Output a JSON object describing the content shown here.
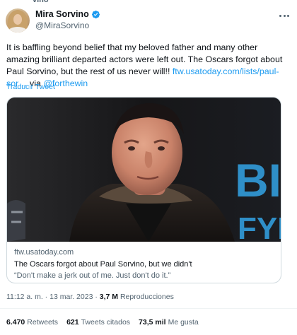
{
  "top_clip": "vino",
  "author": {
    "display_name": "Mira Sorvino",
    "handle": "@MiraSorvino",
    "verified": true,
    "verified_color": "#1d9bf0"
  },
  "tweet": {
    "text_before": "It is baffling beyond belief that my beloved father and many other amazing brilliant departed actors were left out. The Oscars forgot about Paul Sorvino, but the rest of us never will!! ",
    "link_text": "ftw.usatoday.com/lists/paul-sor…",
    "via_text": " via ",
    "mention": "@forthewin",
    "translate_label": "Traducir Tweet"
  },
  "card": {
    "domain": "ftw.usatoday.com",
    "title": "The Oscars forgot about Paul Sorvino, but we didn't",
    "description": "“Don't make a jerk out of me. Just don't do it.”",
    "backdrop_text_1": "BI",
    "backdrop_text_2": "FYI"
  },
  "meta": {
    "time": "11:12 a. m.",
    "separator": " · ",
    "date": "13 mar. 2023",
    "views_value": "3,7 M",
    "views_label": "Reproducciones"
  },
  "stats": [
    {
      "value": "6.470",
      "label": "Retweets"
    },
    {
      "value": "621",
      "label": "Tweets citados"
    },
    {
      "value": "73,5 mil",
      "label": "Me gusta"
    }
  ],
  "colors": {
    "link": "#1d9bf0",
    "secondary_text": "#536471",
    "border": "#cfd9de"
  }
}
